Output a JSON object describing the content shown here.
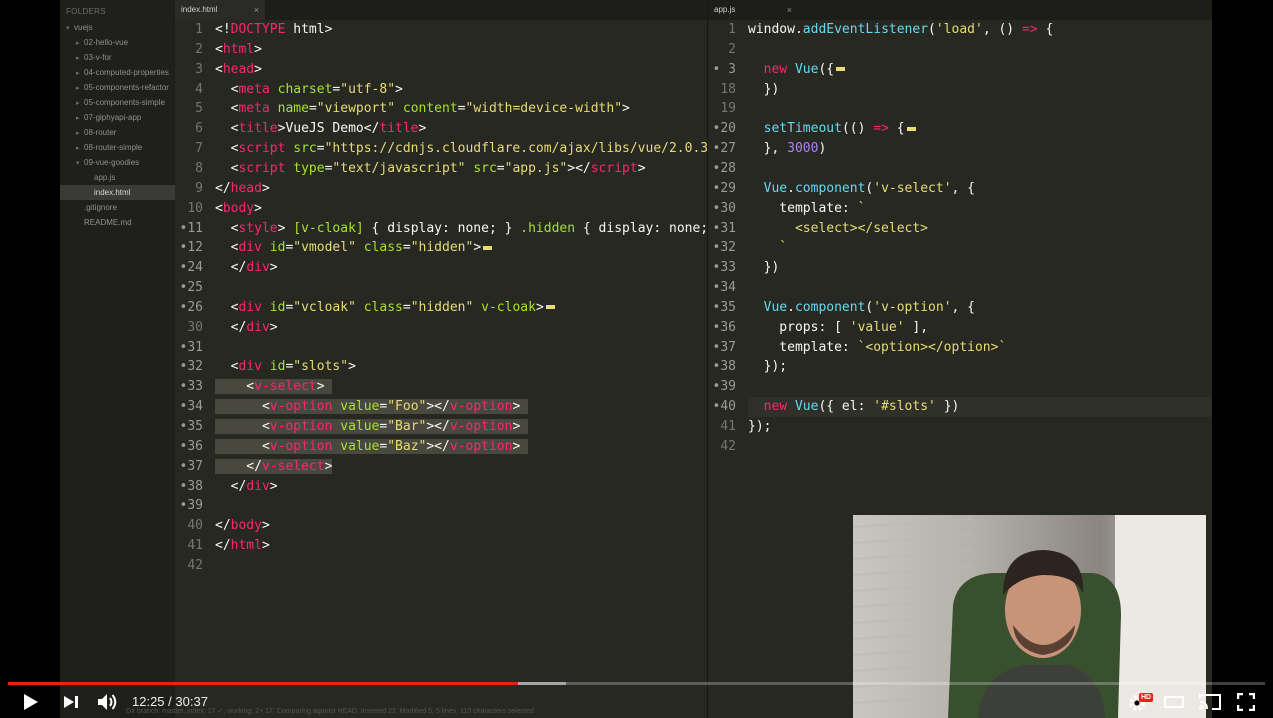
{
  "sidebar": {
    "header": "FOLDERS",
    "items": [
      {
        "label": "vuejs",
        "depth": 0,
        "expanded": true
      },
      {
        "label": "02-hello-vue",
        "depth": 1
      },
      {
        "label": "03-v-for",
        "depth": 1
      },
      {
        "label": "04-computed-properties",
        "depth": 1
      },
      {
        "label": "05-components-refactor",
        "depth": 1
      },
      {
        "label": "05-components-simple",
        "depth": 1
      },
      {
        "label": "07-giphyapi-app",
        "depth": 1
      },
      {
        "label": "08-router",
        "depth": 1
      },
      {
        "label": "08-router-simple",
        "depth": 1
      },
      {
        "label": "09-vue-goodies",
        "depth": 1,
        "expanded": true
      },
      {
        "label": "app.js",
        "depth": 2
      },
      {
        "label": "index.html",
        "depth": 2,
        "active": true
      },
      {
        "label": ".gitignore",
        "depth": 1
      },
      {
        "label": "README.md",
        "depth": 1
      }
    ]
  },
  "tabs": {
    "left": {
      "label": "index.html",
      "close": "×"
    },
    "right": {
      "label": "app.js",
      "close": "×"
    }
  },
  "left_editor": {
    "lines": [
      {
        "n": "1",
        "html": "<span class=\"code\">&lt;!<span class=\"t\">DOCTYPE</span> html&gt;</span>"
      },
      {
        "n": "2",
        "html": "<span class=\"code\">&lt;<span class=\"t\">html</span>&gt;</span>"
      },
      {
        "n": "3",
        "html": "<span class=\"code\">&lt;<span class=\"t\">head</span>&gt;</span>"
      },
      {
        "n": "4",
        "html": "<span class=\"code\">  &lt;<span class=\"t\">meta</span> <span class=\"a\">charset</span>=<span class=\"s\">\"utf-8\"</span>&gt;</span>"
      },
      {
        "n": "5",
        "html": "<span class=\"code\">  &lt;<span class=\"t\">meta</span> <span class=\"a\">name</span>=<span class=\"s\">\"viewport\"</span> <span class=\"a\">content</span>=<span class=\"s\">\"width=device-width\"</span>&gt;</span>"
      },
      {
        "n": "6",
        "html": "<span class=\"code\">  &lt;<span class=\"t\">title</span>&gt;VueJS Demo&lt;/<span class=\"t\">title</span>&gt;</span>"
      },
      {
        "n": "7",
        "html": "<span class=\"code\">  &lt;<span class=\"t\">script</span> <span class=\"a\">src</span>=<span class=\"s\">\"https://cdnjs.cloudflare.com/ajax/libs/vue/2.0.3</span></span>"
      },
      {
        "n": "8",
        "html": "<span class=\"code\">  &lt;<span class=\"t\">script</span> <span class=\"a\">type</span>=<span class=\"s\">\"text/javascript\"</span> <span class=\"a\">src</span>=<span class=\"s\">\"app.js\"</span>&gt;&lt;/<span class=\"t\">script</span>&gt;</span>"
      },
      {
        "n": "9",
        "html": "<span class=\"code\">&lt;/<span class=\"t\">head</span>&gt;</span>"
      },
      {
        "n": "10",
        "html": "<span class=\"code\">&lt;<span class=\"t\">body</span>&gt;</span>"
      },
      {
        "n": "•11",
        "mod": true,
        "html": "<span class=\"code\">  &lt;<span class=\"t\">style</span>&gt; <span class=\"a\">[v-cloak]</span> { display: none; } <span class=\"a\">.hidden</span> { display: none;</span>"
      },
      {
        "n": "•12",
        "mod": true,
        "html": "<span class=\"code\">  &lt;<span class=\"t\">div</span> <span class=\"a\">id</span>=<span class=\"s\">\"vmodel\"</span> <span class=\"a\">class</span>=<span class=\"s\">\"hidden\"</span>&gt;<span class=\"fold\"></span></span>"
      },
      {
        "n": "•24",
        "mod": true,
        "html": "<span class=\"code\">  &lt;/<span class=\"t\">div</span>&gt;</span>"
      },
      {
        "n": "•25",
        "mod": true,
        "html": ""
      },
      {
        "n": "•26",
        "mod": true,
        "html": "<span class=\"code\">  &lt;<span class=\"t\">div</span> <span class=\"a\">id</span>=<span class=\"s\">\"vcloak\"</span> <span class=\"a\">class</span>=<span class=\"s\">\"hidden\"</span> <span class=\"a\">v-cloak</span>&gt;<span class=\"fold\"></span></span>"
      },
      {
        "n": "30",
        "html": "<span class=\"code\">  &lt;/<span class=\"t\">div</span>&gt;</span>"
      },
      {
        "n": "•31",
        "mod": true,
        "html": ""
      },
      {
        "n": "•32",
        "mod": true,
        "html": "<span class=\"code\">  &lt;<span class=\"t\">div</span> <span class=\"a\">id</span>=<span class=\"s\">\"slots\"</span>&gt;</span>"
      },
      {
        "n": "•33",
        "mod": true,
        "selected": true,
        "html": "<span class=\"code sel\">    &lt;<span class=\"t\">v-select</span>&gt; </span>"
      },
      {
        "n": "•34",
        "mod": true,
        "selected": true,
        "html": "<span class=\"code sel\">      &lt;<span class=\"t\">v-option</span> <span class=\"a\">value</span>=<span class=\"s\">\"Foo\"</span>&gt;&lt;/<span class=\"t\">v-option</span>&gt; </span>"
      },
      {
        "n": "•35",
        "mod": true,
        "selected": true,
        "html": "<span class=\"code sel\">      &lt;<span class=\"t\">v-option</span> <span class=\"a\">value</span>=<span class=\"s\">\"Bar\"</span>&gt;&lt;/<span class=\"t\">v-option</span>&gt; </span>"
      },
      {
        "n": "•36",
        "mod": true,
        "selected": true,
        "html": "<span class=\"code sel\">      &lt;<span class=\"t\">v-option</span> <span class=\"a\">value</span>=<span class=\"s\">\"Baz\"</span>&gt;&lt;/<span class=\"t\">v-option</span>&gt; </span>"
      },
      {
        "n": "•37",
        "mod": true,
        "selected": true,
        "html": "<span class=\"code sel\">    &lt;/<span class=\"t\">v-select</span>&gt;</span>"
      },
      {
        "n": "•38",
        "mod": true,
        "html": "<span class=\"code\">  &lt;/<span class=\"t\">div</span>&gt;</span>"
      },
      {
        "n": "•39",
        "mod": true,
        "html": ""
      },
      {
        "n": "40",
        "html": "<span class=\"code\">&lt;/<span class=\"t\">body</span>&gt;</span>"
      },
      {
        "n": "41",
        "html": "<span class=\"code\">&lt;/<span class=\"t\">html</span>&gt;</span>"
      },
      {
        "n": "42",
        "html": ""
      }
    ]
  },
  "right_editor": {
    "cursor_line_index": 19,
    "lines": [
      {
        "n": "1",
        "html": "<span class=\"code\">window.<span class=\"f\">addEventListener</span>(<span class=\"s\">'load'</span>, () <span class=\"o\">=&gt;</span> {</span>"
      },
      {
        "n": "2",
        "html": ""
      },
      {
        "n": "• 3",
        "mod": true,
        "html": "<span class=\"code\">  <span class=\"t\">new</span> <span class=\"f\">Vue</span>({<span class=\"fold\"></span></span>"
      },
      {
        "n": "18",
        "html": "<span class=\"code\">  })</span>"
      },
      {
        "n": "19",
        "html": ""
      },
      {
        "n": "•20",
        "mod": true,
        "html": "<span class=\"code\">  <span class=\"f\">setTimeout</span>(() <span class=\"o\">=&gt;</span> {<span class=\"fold\"></span></span>"
      },
      {
        "n": "•27",
        "mod": true,
        "html": "<span class=\"code\">  }, <span class=\"n\">3000</span>)</span>"
      },
      {
        "n": "•28",
        "mod": true,
        "html": ""
      },
      {
        "n": "•29",
        "mod": true,
        "html": "<span class=\"code\">  <span class=\"f\">Vue</span>.<span class=\"f\">component</span>(<span class=\"s\">'v-select'</span>, {</span>"
      },
      {
        "n": "•30",
        "mod": true,
        "html": "<span class=\"code\">    template: <span class=\"s\">`</span></span>"
      },
      {
        "n": "•31",
        "mod": true,
        "html": "<span class=\"code\"><span class=\"s\">      &lt;select&gt;&lt;/select&gt;</span></span>"
      },
      {
        "n": "•32",
        "mod": true,
        "html": "<span class=\"code\"><span class=\"s\">    `</span></span>"
      },
      {
        "n": "•33",
        "mod": true,
        "html": "<span class=\"code\">  })</span>"
      },
      {
        "n": "•34",
        "mod": true,
        "html": ""
      },
      {
        "n": "•35",
        "mod": true,
        "html": "<span class=\"code\">  <span class=\"f\">Vue</span>.<span class=\"f\">component</span>(<span class=\"s\">'v-option'</span>, {</span>"
      },
      {
        "n": "•36",
        "mod": true,
        "html": "<span class=\"code\">    props: [ <span class=\"s\">'value'</span> ],</span>"
      },
      {
        "n": "•37",
        "mod": true,
        "html": "<span class=\"code\">    template: <span class=\"s\">`&lt;option&gt;&lt;/option&gt;`</span></span>"
      },
      {
        "n": "•38",
        "mod": true,
        "html": "<span class=\"code\">  });</span>"
      },
      {
        "n": "•39",
        "mod": true,
        "html": ""
      },
      {
        "n": "•40",
        "mod": true,
        "html": "<span class=\"code\">  <span class=\"t\">new</span> <span class=\"f\">Vue</span>({ el: <span class=\"s\">'#slots'</span> })</span>"
      },
      {
        "n": "41",
        "html": "<span class=\"code\">});</span>"
      },
      {
        "n": "42",
        "html": ""
      }
    ]
  },
  "statusbar": {
    "text": "Git branch: master, index: 17 ✓, working: 2+ 17, Comparing against HEAD, Inserted 22, Modified 5, 5 lines, 110 characters selected"
  },
  "player": {
    "time_current": "12:25",
    "time_separator": " / ",
    "time_total": "30:37",
    "progress_fraction": 0.406,
    "buffer_fraction": 0.444,
    "hd_badge": "HD",
    "colors": {
      "progress": "#e62117",
      "editor_bg": "#272822"
    }
  },
  "icons": {
    "play": "play-icon",
    "next": "next-icon",
    "volume": "volume-icon",
    "settings": "gear-icon",
    "theater": "theater-mode-icon",
    "cast": "cast-icon",
    "fullscreen": "fullscreen-icon"
  }
}
